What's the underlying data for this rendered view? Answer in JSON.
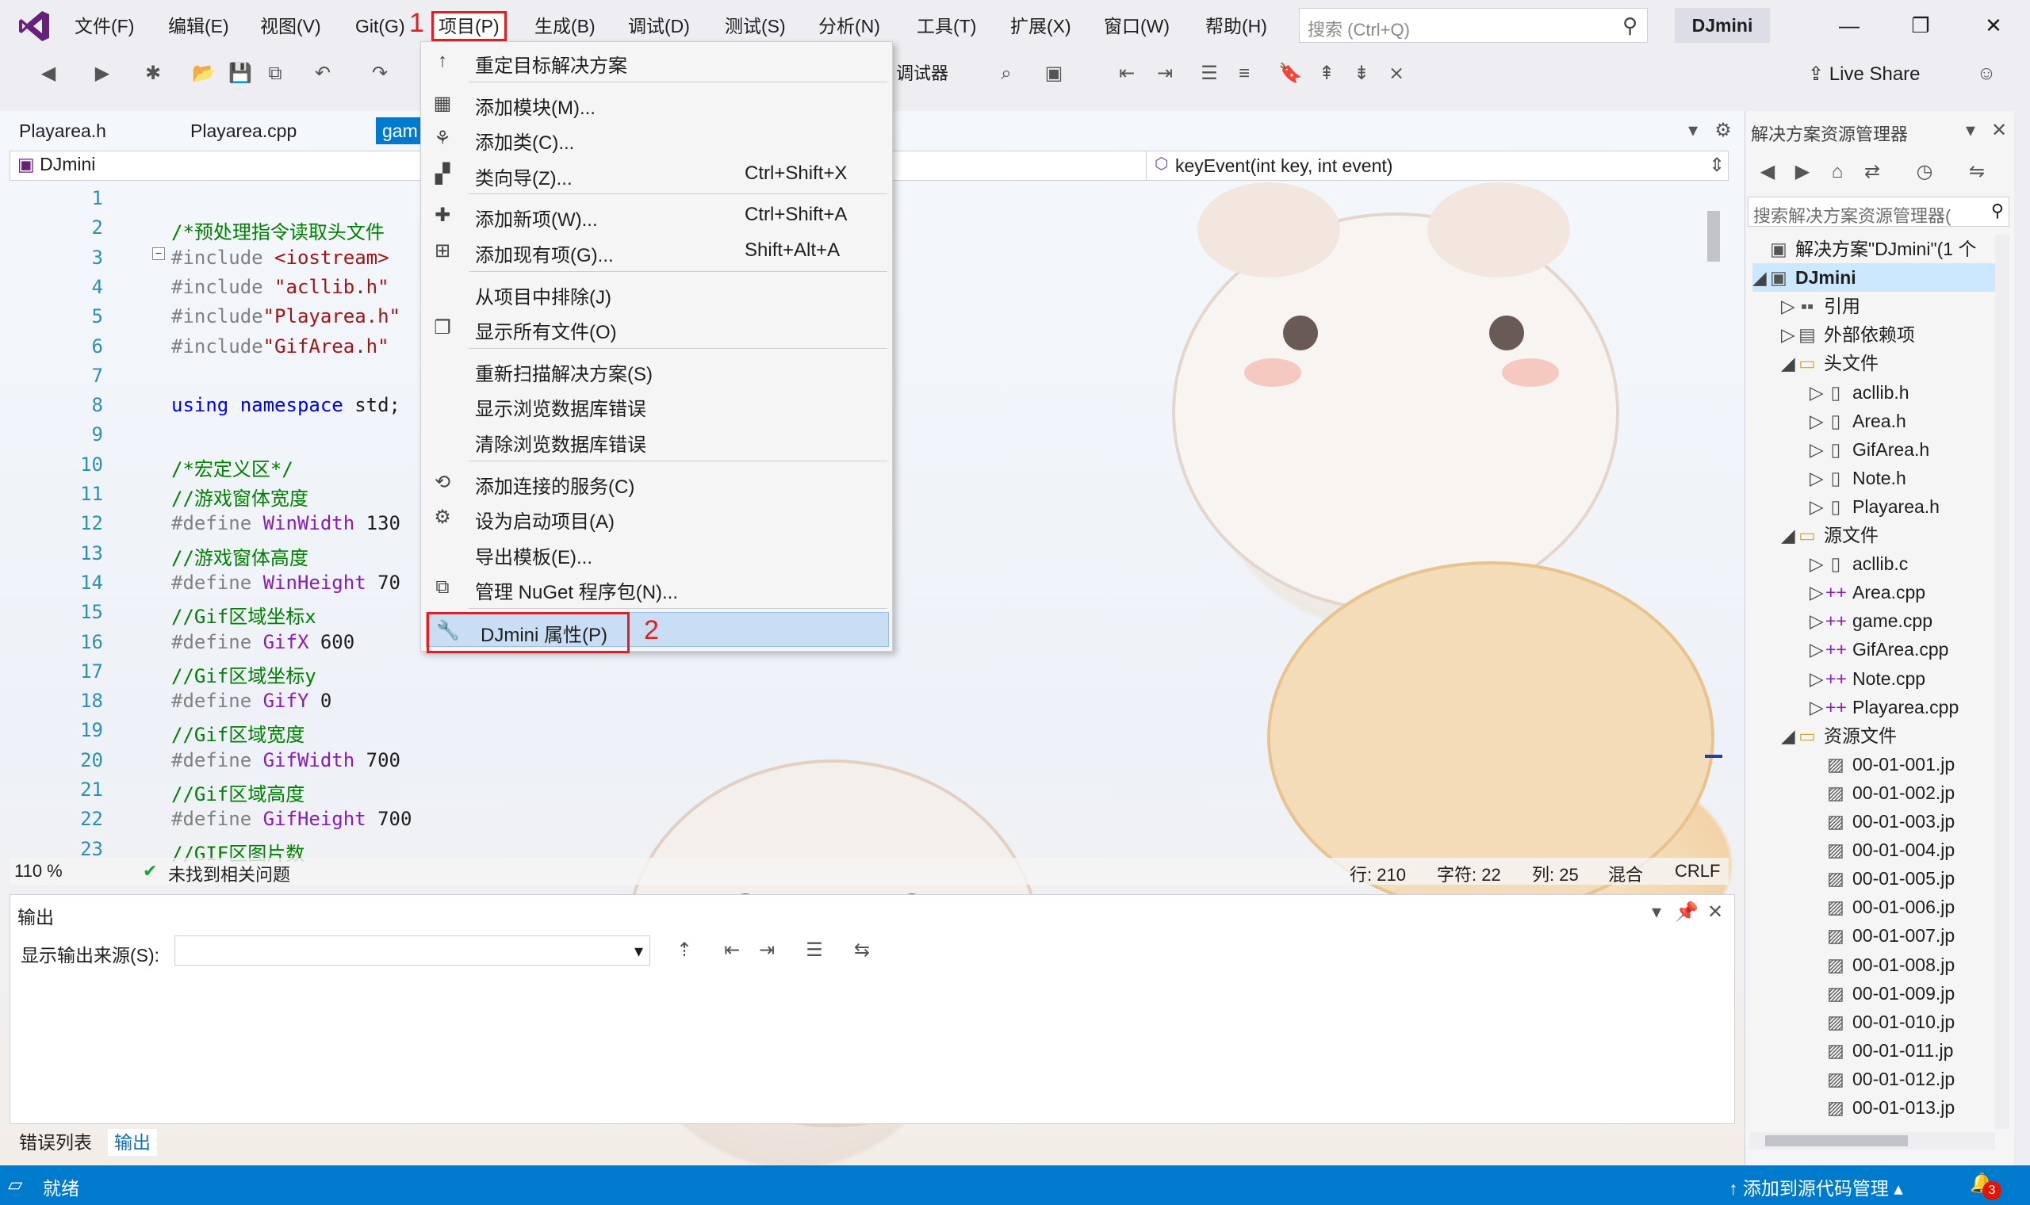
{
  "menubar": {
    "items": [
      "文件(F)",
      "编辑(E)",
      "视图(V)",
      "Git(G)",
      "项目(P)",
      "生成(B)",
      "调试(D)",
      "测试(S)",
      "分析(N)",
      "工具(T)",
      "扩展(X)",
      "窗口(W)",
      "帮助(H)"
    ],
    "search_placeholder": "搜索 (Ctrl+Q)",
    "solution_name": "DJmini"
  },
  "annotations": {
    "step1": "1",
    "step2": "2",
    "accent_color": "#e02020"
  },
  "toolbar": {
    "debugger_label": "调试器",
    "live_share": "Live Share"
  },
  "doc_tabs": [
    "Playarea.h",
    "Playarea.cpp",
    "gam"
  ],
  "nav": {
    "project": "DJmini",
    "function": "keyEvent(int key, int event)"
  },
  "code_lines": [
    {
      "n": "1",
      "parts": []
    },
    {
      "n": "2",
      "parts": [
        [
          "cmt",
          "/*预处理指令读取头文件"
        ]
      ]
    },
    {
      "n": "3",
      "parts": [
        [
          "pp",
          "#include "
        ],
        [
          "str",
          "<iostream>"
        ]
      ]
    },
    {
      "n": "4",
      "parts": [
        [
          "pp",
          "#include "
        ],
        [
          "str",
          "\"acllib.h\""
        ]
      ]
    },
    {
      "n": "5",
      "parts": [
        [
          "pp",
          "#include"
        ],
        [
          "str",
          "\"Playarea.h\""
        ]
      ]
    },
    {
      "n": "6",
      "parts": [
        [
          "pp",
          "#include"
        ],
        [
          "str",
          "\"GifArea.h\""
        ]
      ]
    },
    {
      "n": "7",
      "parts": []
    },
    {
      "n": "8",
      "parts": [
        [
          "kw",
          "using"
        ],
        [
          "txt",
          " "
        ],
        [
          "kw",
          "namespace"
        ],
        [
          "txt",
          " std;"
        ]
      ]
    },
    {
      "n": "9",
      "parts": []
    },
    {
      "n": "10",
      "parts": [
        [
          "cmt",
          "/*宏定义区*/"
        ]
      ]
    },
    {
      "n": "11",
      "parts": [
        [
          "cmt",
          "//游戏窗体宽度"
        ]
      ]
    },
    {
      "n": "12",
      "parts": [
        [
          "pp",
          "#define "
        ],
        [
          "mac",
          "WinWidth"
        ],
        [
          "txt",
          " 130"
        ]
      ]
    },
    {
      "n": "13",
      "parts": [
        [
          "cmt",
          "//游戏窗体高度"
        ]
      ]
    },
    {
      "n": "14",
      "parts": [
        [
          "pp",
          "#define "
        ],
        [
          "mac",
          "WinHeight"
        ],
        [
          "txt",
          " 70"
        ]
      ]
    },
    {
      "n": "15",
      "parts": [
        [
          "cmt",
          "//Gif区域坐标x"
        ]
      ]
    },
    {
      "n": "16",
      "parts": [
        [
          "pp",
          "#define "
        ],
        [
          "mac",
          "GifX"
        ],
        [
          "txt",
          " 600"
        ]
      ]
    },
    {
      "n": "17",
      "parts": [
        [
          "cmt",
          "//Gif区域坐标y"
        ]
      ]
    },
    {
      "n": "18",
      "parts": [
        [
          "pp",
          "#define "
        ],
        [
          "mac",
          "GifY"
        ],
        [
          "txt",
          " 0"
        ]
      ]
    },
    {
      "n": "19",
      "parts": [
        [
          "cmt",
          "//Gif区域宽度"
        ]
      ]
    },
    {
      "n": "20",
      "parts": [
        [
          "pp",
          "#define "
        ],
        [
          "mac",
          "GifWidth"
        ],
        [
          "txt",
          " 700"
        ]
      ]
    },
    {
      "n": "21",
      "parts": [
        [
          "cmt",
          "//Gif区域高度"
        ]
      ]
    },
    {
      "n": "22",
      "parts": [
        [
          "pp",
          "#define "
        ],
        [
          "mac",
          "GifHeight"
        ],
        [
          "txt",
          " 700"
        ]
      ]
    },
    {
      "n": "23",
      "parts": [
        [
          "cmt",
          "//GIF区图片数"
        ]
      ]
    }
  ],
  "editor_status": {
    "zoom": "110 %",
    "issues": "未找到相关问题",
    "line": "行: 210",
    "char": "字符: 22",
    "col": "列: 25",
    "mixed": "混合",
    "eol": "CRLF"
  },
  "output": {
    "title": "输出",
    "source_label": "显示输出来源(S):",
    "source_value": ""
  },
  "bottom_tabs": [
    "错误列表",
    "输出"
  ],
  "solution_explorer": {
    "title": "解决方案资源管理器",
    "search_placeholder": "搜索解决方案资源管理器(",
    "tree": [
      {
        "label": "解决方案\"DJmini\"(1 个",
        "depth": 0,
        "icon": "solution-icon",
        "glyph": "▣",
        "tri": ""
      },
      {
        "label": "DJmini",
        "depth": 0,
        "icon": "project-icon",
        "glyph": "▣",
        "tri": "◢",
        "bold": true,
        "selected": true
      },
      {
        "label": "引用",
        "depth": 1,
        "icon": "references-icon",
        "glyph": "▪▪",
        "tri": "▷"
      },
      {
        "label": "外部依赖项",
        "depth": 1,
        "icon": "external-deps-icon",
        "glyph": "▤",
        "tri": "▷"
      },
      {
        "label": "头文件",
        "depth": 1,
        "icon": "folder-icon",
        "glyph": "▭",
        "tri": "◢"
      },
      {
        "label": "acllib.h",
        "depth": 2,
        "icon": "header-file-icon",
        "glyph": "▯",
        "tri": "▷"
      },
      {
        "label": "Area.h",
        "depth": 2,
        "icon": "header-file-icon",
        "glyph": "▯",
        "tri": "▷"
      },
      {
        "label": "GifArea.h",
        "depth": 2,
        "icon": "header-file-icon",
        "glyph": "▯",
        "tri": "▷"
      },
      {
        "label": "Note.h",
        "depth": 2,
        "icon": "header-file-icon",
        "glyph": "▯",
        "tri": "▷"
      },
      {
        "label": "Playarea.h",
        "depth": 2,
        "icon": "header-file-icon",
        "glyph": "▯",
        "tri": "▷"
      },
      {
        "label": "源文件",
        "depth": 1,
        "icon": "folder-icon",
        "glyph": "▭",
        "tri": "◢"
      },
      {
        "label": "acllib.c",
        "depth": 2,
        "icon": "c-file-icon",
        "glyph": "▯",
        "tri": "▷"
      },
      {
        "label": "Area.cpp",
        "depth": 2,
        "icon": "cpp-file-icon",
        "glyph": "++",
        "tri": "▷"
      },
      {
        "label": "game.cpp",
        "depth": 2,
        "icon": "cpp-file-icon",
        "glyph": "++",
        "tri": "▷"
      },
      {
        "label": "GifArea.cpp",
        "depth": 2,
        "icon": "cpp-file-icon",
        "glyph": "++",
        "tri": "▷"
      },
      {
        "label": "Note.cpp",
        "depth": 2,
        "icon": "cpp-file-icon",
        "glyph": "++",
        "tri": "▷"
      },
      {
        "label": "Playarea.cpp",
        "depth": 2,
        "icon": "cpp-file-icon",
        "glyph": "++",
        "tri": "▷"
      },
      {
        "label": "资源文件",
        "depth": 1,
        "icon": "folder-icon",
        "glyph": "▭",
        "tri": "◢"
      },
      {
        "label": "00-01-001.jp",
        "depth": 2,
        "icon": "image-file-icon",
        "glyph": "▨",
        "tri": ""
      },
      {
        "label": "00-01-002.jp",
        "depth": 2,
        "icon": "image-file-icon",
        "glyph": "▨",
        "tri": ""
      },
      {
        "label": "00-01-003.jp",
        "depth": 2,
        "icon": "image-file-icon",
        "glyph": "▨",
        "tri": ""
      },
      {
        "label": "00-01-004.jp",
        "depth": 2,
        "icon": "image-file-icon",
        "glyph": "▨",
        "tri": ""
      },
      {
        "label": "00-01-005.jp",
        "depth": 2,
        "icon": "image-file-icon",
        "glyph": "▨",
        "tri": ""
      },
      {
        "label": "00-01-006.jp",
        "depth": 2,
        "icon": "image-file-icon",
        "glyph": "▨",
        "tri": ""
      },
      {
        "label": "00-01-007.jp",
        "depth": 2,
        "icon": "image-file-icon",
        "glyph": "▨",
        "tri": ""
      },
      {
        "label": "00-01-008.jp",
        "depth": 2,
        "icon": "image-file-icon",
        "glyph": "▨",
        "tri": ""
      },
      {
        "label": "00-01-009.jp",
        "depth": 2,
        "icon": "image-file-icon",
        "glyph": "▨",
        "tri": ""
      },
      {
        "label": "00-01-010.jp",
        "depth": 2,
        "icon": "image-file-icon",
        "glyph": "▨",
        "tri": ""
      },
      {
        "label": "00-01-011.jp",
        "depth": 2,
        "icon": "image-file-icon",
        "glyph": "▨",
        "tri": ""
      },
      {
        "label": "00-01-012.jp",
        "depth": 2,
        "icon": "image-file-icon",
        "glyph": "▨",
        "tri": ""
      },
      {
        "label": "00-01-013.jp",
        "depth": 2,
        "icon": "image-file-icon",
        "glyph": "▨",
        "tri": ""
      }
    ]
  },
  "project_menu": {
    "items": [
      {
        "label": "重定目标解决方案",
        "shortcut": "",
        "icon": "retarget-arrow-icon",
        "glyph": "↑"
      },
      {
        "sep": true
      },
      {
        "label": "添加模块(M)...",
        "shortcut": "",
        "icon": "add-module-icon",
        "glyph": "▦"
      },
      {
        "label": "添加类(C)...",
        "shortcut": "",
        "icon": "add-class-icon",
        "glyph": "⚘"
      },
      {
        "label": "类向导(Z)...",
        "shortcut": "Ctrl+Shift+X",
        "icon": "class-wizard-icon",
        "glyph": "▞"
      },
      {
        "sep": true
      },
      {
        "label": "添加新项(W)...",
        "shortcut": "Ctrl+Shift+A",
        "icon": "add-new-item-icon",
        "glyph": "✚"
      },
      {
        "label": "添加现有项(G)...",
        "shortcut": "Shift+Alt+A",
        "icon": "add-existing-item-icon",
        "glyph": "⊞"
      },
      {
        "sep": true
      },
      {
        "label": "从项目中排除(J)",
        "shortcut": "",
        "icon": "",
        "glyph": ""
      },
      {
        "label": "显示所有文件(O)",
        "shortcut": "",
        "icon": "show-all-files-icon",
        "glyph": "❐"
      },
      {
        "sep": true
      },
      {
        "label": "重新扫描解决方案(S)",
        "shortcut": "",
        "icon": "",
        "glyph": ""
      },
      {
        "label": "显示浏览数据库错误",
        "shortcut": "",
        "icon": "",
        "glyph": ""
      },
      {
        "label": "清除浏览数据库错误",
        "shortcut": "",
        "icon": "",
        "glyph": ""
      },
      {
        "sep": true
      },
      {
        "label": "添加连接的服务(C)",
        "shortcut": "",
        "icon": "connected-service-icon",
        "glyph": "⟲"
      },
      {
        "label": "设为启动项目(A)",
        "shortcut": "",
        "icon": "gear-icon",
        "glyph": "⚙"
      },
      {
        "label": "导出模板(E)...",
        "shortcut": "",
        "icon": "",
        "glyph": ""
      },
      {
        "label": "管理 NuGet 程序包(N)...",
        "shortcut": "",
        "icon": "nuget-package-icon",
        "glyph": "⧉"
      },
      {
        "sep": true
      },
      {
        "label": "DJmini 属性(P)",
        "shortcut": "",
        "icon": "wrench-icon",
        "glyph": "🔧",
        "highlight": true
      }
    ]
  },
  "statusbar": {
    "text": "就绪",
    "add_source": "添加到源代码管理",
    "notifications": "3"
  }
}
